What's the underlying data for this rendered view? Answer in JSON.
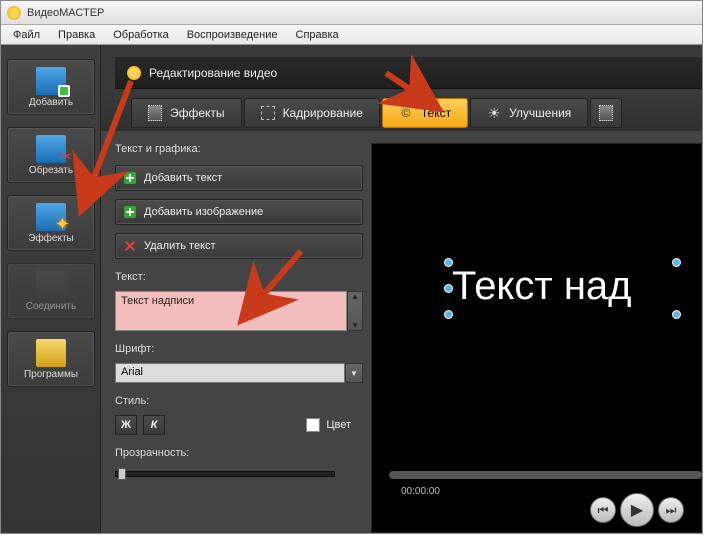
{
  "app": {
    "title": "ВидеоМАСТЕР"
  },
  "menu": {
    "file": "Файл",
    "edit": "Правка",
    "process": "Обработка",
    "playback": "Воспроизведение",
    "help": "Справка"
  },
  "sidebar": {
    "add": "Добавить",
    "cut": "Обрезать",
    "effects": "Эффекты",
    "join": "Соединить",
    "programs": "Программы"
  },
  "editor": {
    "title": "Редактирование видео"
  },
  "tabs": {
    "effects": "Эффекты",
    "crop": "Кадрирование",
    "text": "Текст",
    "enhance": "Улучшения"
  },
  "panel": {
    "section": "Текст и графика:",
    "add_text": "Добавить текст",
    "add_image": "Добавить изображение",
    "del_text": "Удалить текст",
    "text_label": "Текст:",
    "text_value": "Текст надписи",
    "font_label": "Шрифт:",
    "font_value": "Arial",
    "style_label": "Стиль:",
    "bold": "Ж",
    "italic": "К",
    "color": "Цвет",
    "opacity": "Прозрачность:"
  },
  "preview": {
    "overlay": "Текст над"
  },
  "playback": {
    "time": "00:00:00"
  }
}
